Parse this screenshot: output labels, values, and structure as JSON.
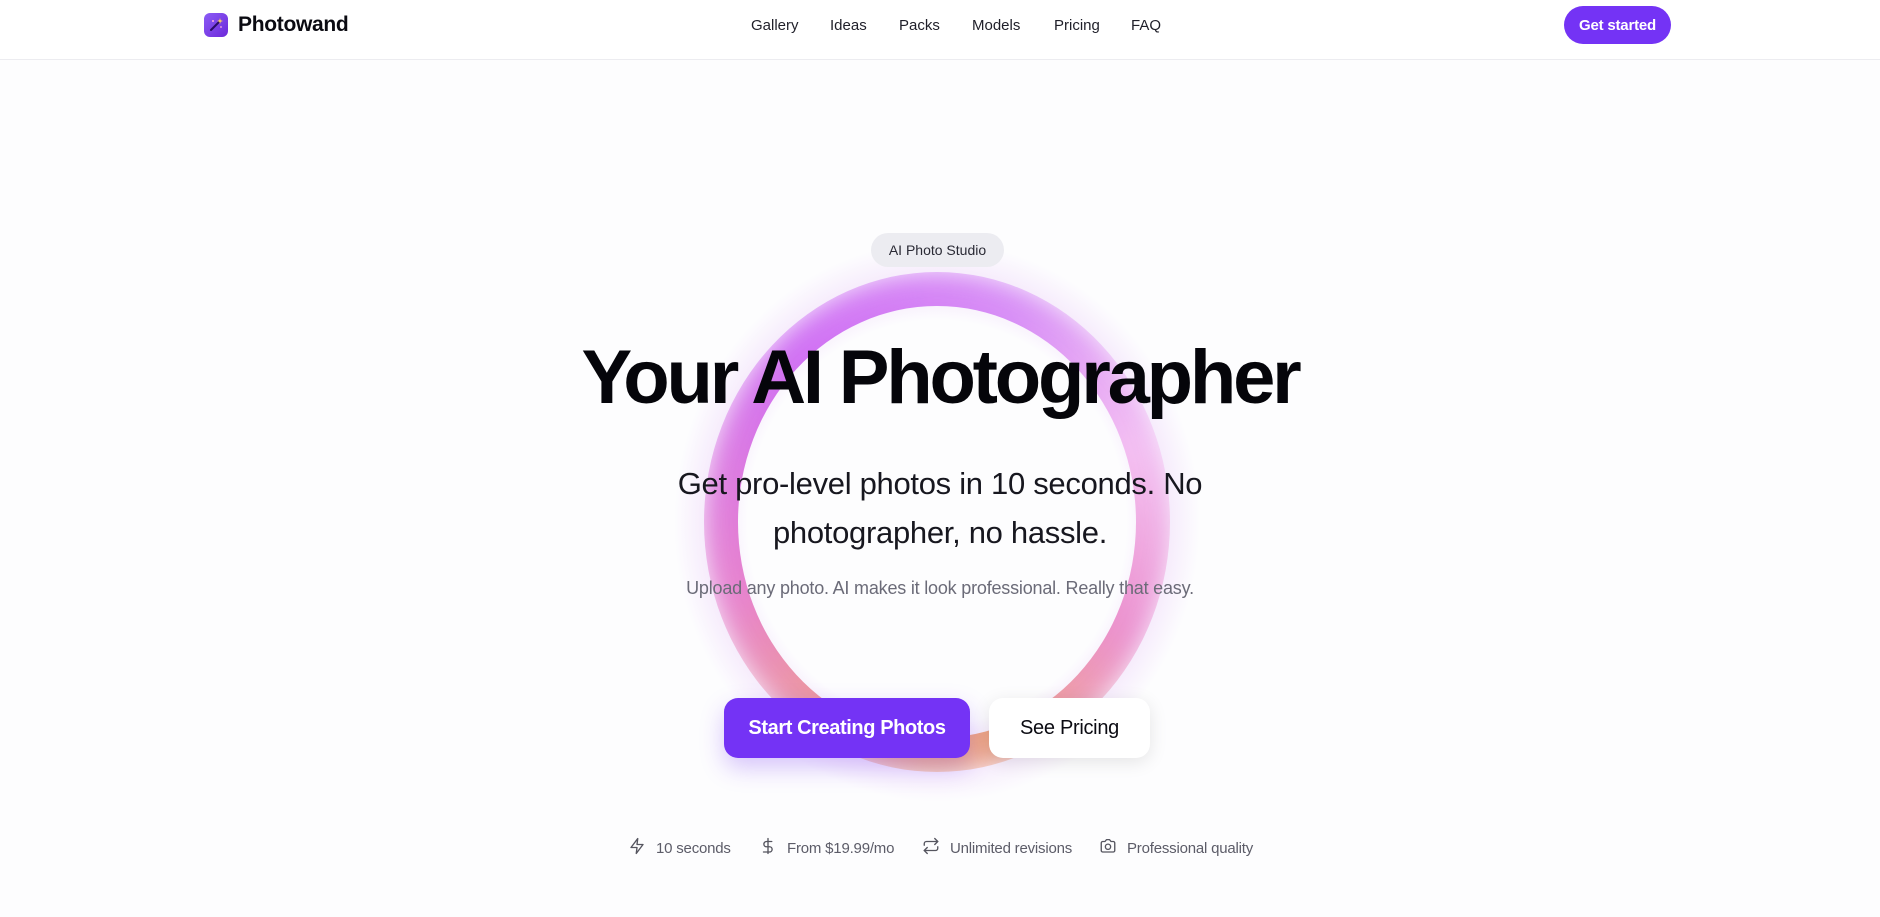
{
  "header": {
    "brand_name": "Photowand",
    "brand_icon": "magic-wand-icon",
    "nav": [
      {
        "label": "Gallery"
      },
      {
        "label": "Ideas"
      },
      {
        "label": "Packs"
      },
      {
        "label": "Models"
      },
      {
        "label": "Pricing"
      },
      {
        "label": "FAQ"
      }
    ],
    "cta_label": "Get started"
  },
  "hero": {
    "badge": "AI Photo Studio",
    "title": "Your AI Photographer",
    "subtitle": "Get pro-level photos in 10 seconds. No photographer, no hassle.",
    "description": "Upload any photo. AI makes it look professional. Really that easy.",
    "primary_button": "Start Creating Photos",
    "secondary_button": "See Pricing"
  },
  "features": [
    {
      "icon": "lightning-icon",
      "label": "10 seconds"
    },
    {
      "icon": "dollar-icon",
      "label": "From $19.99/mo"
    },
    {
      "icon": "repeat-icon",
      "label": "Unlimited revisions"
    },
    {
      "icon": "camera-icon",
      "label": "Professional quality"
    }
  ],
  "colors": {
    "accent": "#7433f5",
    "background": "#fdfdfe",
    "badge_bg": "#ececf1",
    "text_primary": "#05050a",
    "text_muted": "#6b6b78"
  }
}
